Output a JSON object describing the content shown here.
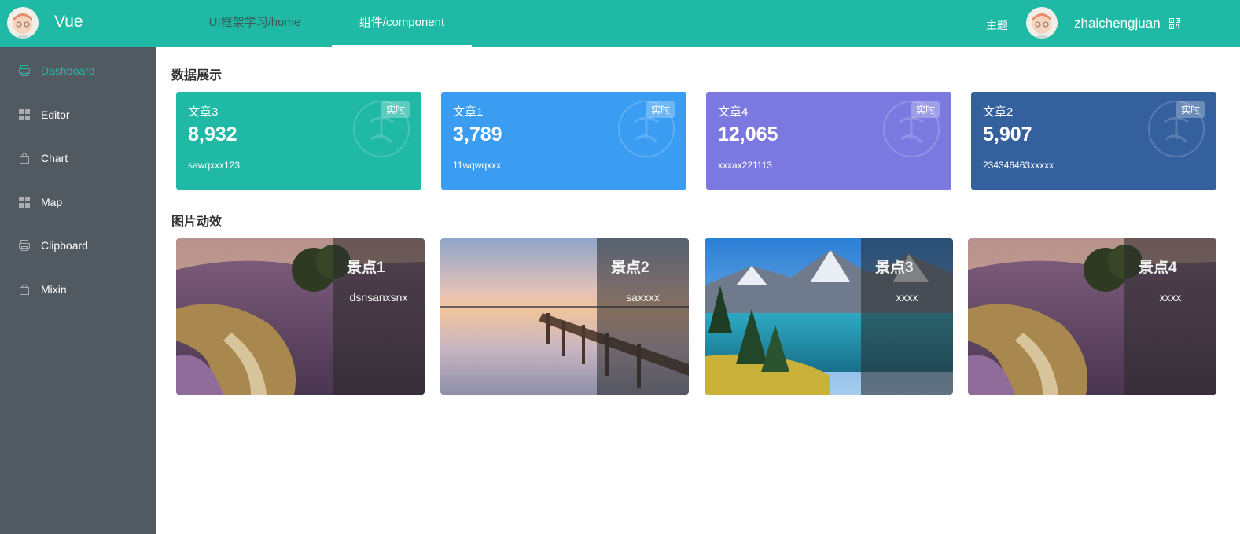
{
  "header": {
    "app_title": "Vue",
    "tabs": [
      {
        "label": "UI框架学习/home"
      },
      {
        "label": "组件/component"
      }
    ],
    "theme_label": "主题",
    "user_name": "zhaichengjuan"
  },
  "sidebar": {
    "items": [
      {
        "label": "Dashboard",
        "icon": "printer-icon"
      },
      {
        "label": "Editor",
        "icon": "grid-icon"
      },
      {
        "label": "Chart",
        "icon": "bag-icon"
      },
      {
        "label": "Map",
        "icon": "grid-icon"
      },
      {
        "label": "Clipboard",
        "icon": "printer-icon"
      },
      {
        "label": "Mixin",
        "icon": "bag-icon"
      }
    ]
  },
  "sections": {
    "data_title": "数据展示",
    "pictures_title": "图片动效"
  },
  "stats": [
    {
      "name": "文章3",
      "value": "8,932",
      "desc": "sawqxxx123",
      "tag": "实时",
      "color": "#20b9a6"
    },
    {
      "name": "文章1",
      "value": "3,789",
      "desc": "11wqwqxxx",
      "tag": "实时",
      "color": "#3a9df2"
    },
    {
      "name": "文章4",
      "value": "12,065",
      "desc": "xxxax221113",
      "tag": "实时",
      "color": "#7b79e0"
    },
    {
      "name": "文章2",
      "value": "5,907",
      "desc": "234346463xxxxx",
      "tag": "实时",
      "color": "#34609e"
    }
  ],
  "pictures": [
    {
      "title": "景点1",
      "desc": "dsnsanxsnx",
      "scene": "meadow"
    },
    {
      "title": "景点2",
      "desc": "saxxxx",
      "scene": "pier"
    },
    {
      "title": "景点3",
      "desc": "xxxx",
      "scene": "lake"
    },
    {
      "title": "景点4",
      "desc": "xxxx",
      "scene": "meadow"
    }
  ],
  "colors": {
    "accent": "#20b9a6",
    "sidebar_bg": "#525a61"
  }
}
